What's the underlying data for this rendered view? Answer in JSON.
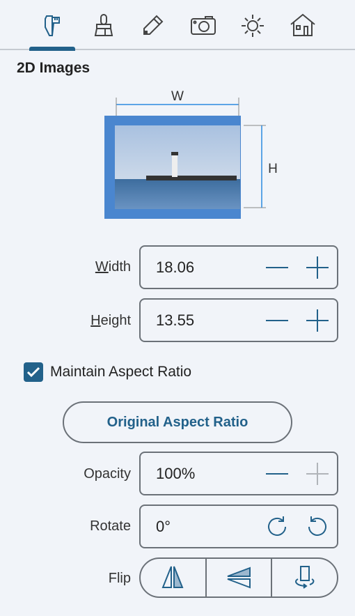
{
  "tabs": [
    {
      "icon": "caliper-icon",
      "active": true
    },
    {
      "icon": "brush-icon"
    },
    {
      "icon": "pencil-icon"
    },
    {
      "icon": "camera-icon"
    },
    {
      "icon": "sun-icon"
    },
    {
      "icon": "house-icon"
    }
  ],
  "section_title": "2D Images",
  "preview": {
    "w_label": "W",
    "h_label": "H",
    "frame_color": "#4a86cf"
  },
  "width": {
    "label_ul": "W",
    "label_rest": "idth",
    "value": "18.06"
  },
  "height": {
    "label_ul": "H",
    "label_rest": "eight",
    "value": "13.55"
  },
  "maintain_aspect": {
    "label": "Maintain Aspect Ratio",
    "checked": true
  },
  "original_aspect_button": "Original Aspect Ratio",
  "opacity": {
    "label": "Opacity",
    "value": "100%"
  },
  "rotate": {
    "label": "Rotate",
    "value": "0°"
  },
  "flip": {
    "label": "Flip"
  },
  "accent": "#22618a"
}
